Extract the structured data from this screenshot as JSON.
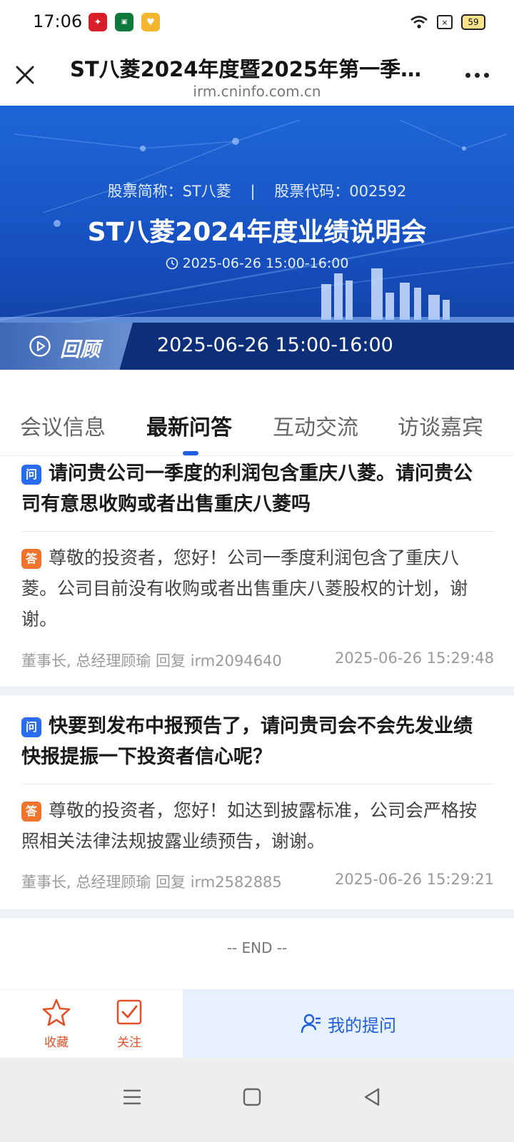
{
  "status": {
    "time": "17:06",
    "battery": "59"
  },
  "header": {
    "title": "ST八菱2024年度暨2025年第一季度...",
    "url": "irm.cninfo.com.cn"
  },
  "banner": {
    "meta": "股票简称：ST八菱    |    股票代码：002592",
    "title": "ST八菱2024年度业绩说明会",
    "time": "2025-06-26  15:00-16:00",
    "replay_label": "回顾",
    "replay_time": "2025-06-26 15:00-16:00"
  },
  "tabs": [
    {
      "label": "会议信息"
    },
    {
      "label": "最新问答"
    },
    {
      "label": "互动交流"
    },
    {
      "label": "访谈嘉宾"
    }
  ],
  "qa": [
    {
      "q_badge": "问",
      "question": "请问贵公司一季度的利润包含重庆八菱。请问贵公司有意思收购或者出售重庆八菱吗",
      "a_badge": "答",
      "answer": "尊敬的投资者，您好！公司一季度利润包含了重庆八菱。公司目前没有收购或者出售重庆八菱股权的计划，谢谢。",
      "reply_info": "董事长, 总经理顾瑜 回复 irm2094640",
      "reply_time": "2025-06-26 15:29:48"
    },
    {
      "q_badge": "问",
      "question": "快要到发布中报预告了，请问贵司会不会先发业绩快报提振一下投资者信心呢？",
      "a_badge": "答",
      "answer": "尊敬的投资者，您好！如达到披露标准，公司会严格按照相关法律法规披露业绩预告，谢谢。",
      "reply_info": "董事长, 总经理顾瑜 回复 irm2582885",
      "reply_time": "2025-06-26 15:29:21"
    }
  ],
  "end_text": "-- END --",
  "bottom": {
    "favorite_label": "收藏",
    "follow_label": "关注",
    "ask_label": "我的提问"
  }
}
